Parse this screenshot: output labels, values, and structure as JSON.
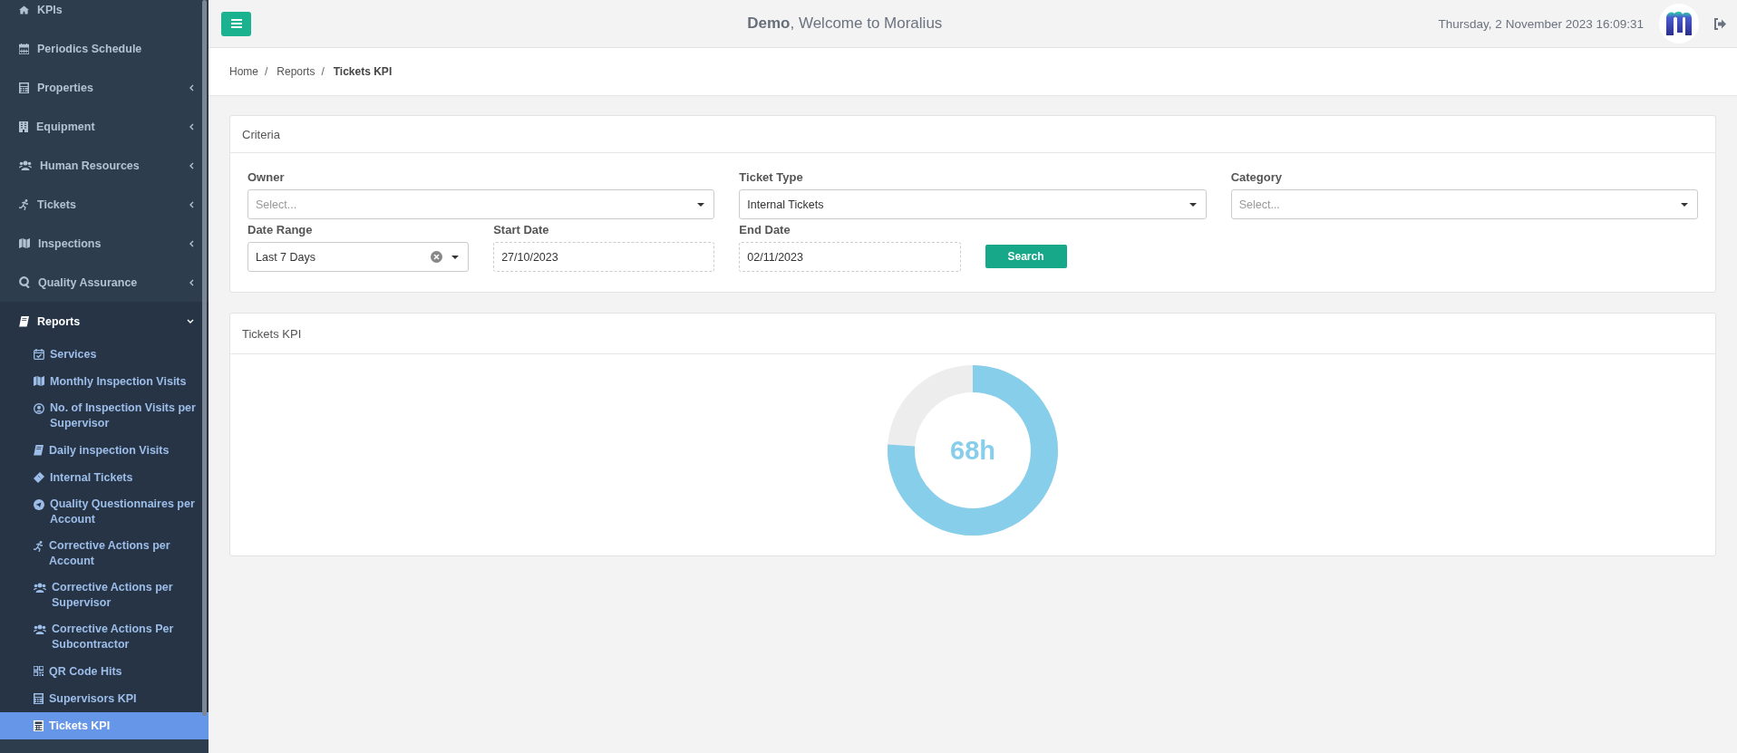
{
  "header": {
    "welcome": "**Demo**, Welcome to Moralius",
    "datetime": "Thursday, 2 November 2023 16:09:31"
  },
  "sidebar": {
    "items": [
      {
        "label": "KPIs",
        "kind": "link"
      },
      {
        "label": "Periodics Schedule",
        "kind": "link"
      },
      {
        "label": "Properties",
        "kind": "menu",
        "expanded": false
      },
      {
        "label": "Equipment",
        "kind": "menu",
        "expanded": false
      },
      {
        "label": "Human Resources",
        "kind": "menu",
        "expanded": false
      },
      {
        "label": "Tickets",
        "kind": "menu",
        "expanded": false
      },
      {
        "label": "Inspections",
        "kind": "menu",
        "expanded": false
      },
      {
        "label": "Quality Assurance",
        "kind": "menu",
        "expanded": false
      },
      {
        "label": "Reports",
        "kind": "menu",
        "expanded": true,
        "children": [
          {
            "label": "Services",
            "selected": false
          },
          {
            "label": "Monthly Inspection Visits",
            "selected": false
          },
          {
            "label": "No. of Inspection Visits per Supervisor",
            "selected": false
          },
          {
            "label": "Daily inspection Visits",
            "selected": false
          },
          {
            "label": "Internal Tickets",
            "selected": false
          },
          {
            "label": "Quality Questionnaires per Account",
            "selected": false
          },
          {
            "label": "Corrective Actions per Account",
            "selected": false
          },
          {
            "label": "Corrective Actions per Supervisor",
            "selected": false
          },
          {
            "label": "Corrective Actions Per Subcontractor",
            "selected": false
          },
          {
            "label": "QR Code Hits",
            "selected": false
          },
          {
            "label": "Supervisors KPI",
            "selected": false
          },
          {
            "label": "Tickets KPI",
            "selected": true
          }
        ]
      }
    ]
  },
  "breadcrumb": {
    "separator": "/",
    "items": [
      {
        "label": "Home",
        "selected": false
      },
      {
        "label": "Reports",
        "selected": false
      },
      {
        "label": "Tickets KPI",
        "selected": true
      }
    ]
  },
  "criteria": {
    "title": "Criteria",
    "fields": [
      {
        "kind": "select",
        "label": "Owner",
        "placeholder": "Select...",
        "clearable": false
      },
      {
        "kind": "select",
        "label": "Ticket Type",
        "value": "Internal Tickets",
        "clearable": false
      },
      {
        "kind": "select",
        "label": "Category",
        "placeholder": "Select...",
        "clearable": false
      },
      {
        "kind": "select",
        "label": "Date Range",
        "value": "Last 7 Days",
        "clearable": true
      },
      {
        "kind": "date",
        "label": "Start Date",
        "value": "27/10/2023"
      },
      {
        "kind": "date",
        "label": "End Date",
        "value": "02/11/2023"
      }
    ],
    "search_button": "Search"
  },
  "kpi": {
    "title": "Tickets KPI",
    "gauge": {
      "value": "68h"
    }
  }
}
